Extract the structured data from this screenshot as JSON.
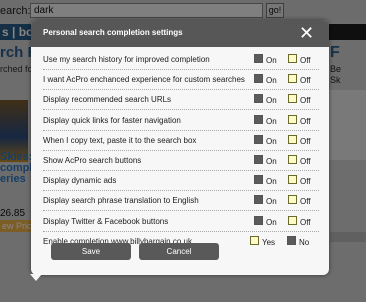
{
  "background": {
    "search_label": "earch:",
    "search_value": "dark",
    "go_label": "go!",
    "nav_text": "s | boo",
    "heading": "rch Re",
    "subtext": "rched fo",
    "right_heading": "F",
    "right_text": "Be\nSk",
    "product_text": "Skies: Th\ncomplete\neries",
    "price": "26.85",
    "price_link": "ew Price"
  },
  "modal": {
    "title": "Personal search completion settings",
    "close_label": "✕",
    "rows": [
      {
        "label": "Use my search history for improved completion",
        "opt1": "On",
        "opt2": "Off",
        "selected": "opt2"
      },
      {
        "label": "I want AcPro enchanced experience for custom searches",
        "opt1": "On",
        "opt2": "Off",
        "selected": "opt2"
      },
      {
        "label": "Display recommended search URLs",
        "opt1": "On",
        "opt2": "Off",
        "selected": "opt2"
      },
      {
        "label": "Display quick links for faster navigation",
        "opt1": "On",
        "opt2": "Off",
        "selected": "opt2"
      },
      {
        "label": "When I copy text, paste it to the search box",
        "opt1": "On",
        "opt2": "Off",
        "selected": "opt2"
      },
      {
        "label": "Show AcPro search buttons",
        "opt1": "On",
        "opt2": "Off",
        "selected": "opt2"
      },
      {
        "label": "Display dynamic ads",
        "opt1": "On",
        "opt2": "Off",
        "selected": "opt2"
      },
      {
        "label": "Display search phrase translation to English",
        "opt1": "On",
        "opt2": "Off",
        "selected": "opt2"
      },
      {
        "label": "Display Twitter & Facebook buttons",
        "opt1": "On",
        "opt2": "Off",
        "selected": "opt2"
      },
      {
        "label": "Enable completion www.billybargain.co.uk",
        "opt1": "Yes",
        "opt2": "No",
        "selected": "opt1"
      }
    ],
    "save_label": "Save",
    "cancel_label": "Cancel"
  },
  "colors": {
    "titlebar": "#575757",
    "selected_box": "#fffbc6",
    "unselected_box": "#5b5b5b",
    "button": "#595959"
  }
}
